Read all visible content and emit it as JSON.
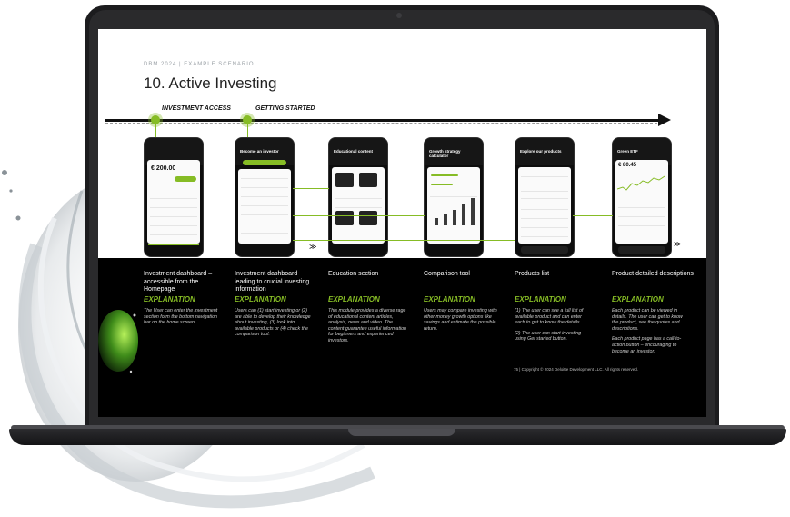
{
  "slide": {
    "eyebrow": "DBM 2024 | EXAMPLE SCENARIO",
    "title": "10. Active Investing",
    "steps": [
      "INVESTMENT ACCESS",
      "GETTING STARTED"
    ],
    "copyright": "75 | Copyright © 2024 Deloitte Development LLC. All rights reserved."
  },
  "colors": {
    "accent": "#86bc25",
    "dark": "#000000",
    "slide_bg": "#ffffff"
  },
  "columns": [
    {
      "caption": "Investment dashboard – accessible from the Homepage",
      "explanation_heading": "EXPLANATION",
      "explanation": [
        "The User can enter the investment section form the bottom navigation bar on the home screen."
      ],
      "phone_title": "",
      "phone_amount": "€ 200.00"
    },
    {
      "caption": "Investment dashboard leading to crucial investing information",
      "explanation_heading": "EXPLANATION",
      "explanation": [
        "Users can (1) start investing or (2) are able to develop their knowledge about investing, (3) look into available products or (4) check the comparison tool."
      ],
      "phone_title": "Become an investor",
      "phone_amount": ""
    },
    {
      "caption": "Education section",
      "explanation_heading": "EXPLANATION",
      "explanation": [
        "This module provides a diverse rage of educational content articles, analysis, news and video. The content guarantee useful information for beginners and experienced investors."
      ],
      "phone_title": "Educational content",
      "phone_amount": ""
    },
    {
      "caption": "Comparison tool",
      "explanation_heading": "EXPLANATION",
      "explanation": [
        "Users may compare investing with other money growth options like savings and estimate the possible return."
      ],
      "phone_title": "Growth strategy calculator",
      "phone_amount": ""
    },
    {
      "caption": "Products list",
      "explanation_heading": "EXPLANATION",
      "explanation": [
        "(1) The user can see a full list of available product and can enter each to get to know the details.",
        "(2) The user can start investing using Get started button."
      ],
      "phone_title": "Explore our products",
      "phone_amount": ""
    },
    {
      "caption": "Product detailed descriptions",
      "explanation_heading": "EXPLANATION",
      "explanation": [
        "Each product can be viewed in details. The user can get to know the product, see the quotes and descriptions.",
        "Each product page has a call-to-action button – encouraging to become an investor."
      ],
      "phone_title": "Green ETF",
      "phone_amount": "€ 80.45"
    }
  ]
}
